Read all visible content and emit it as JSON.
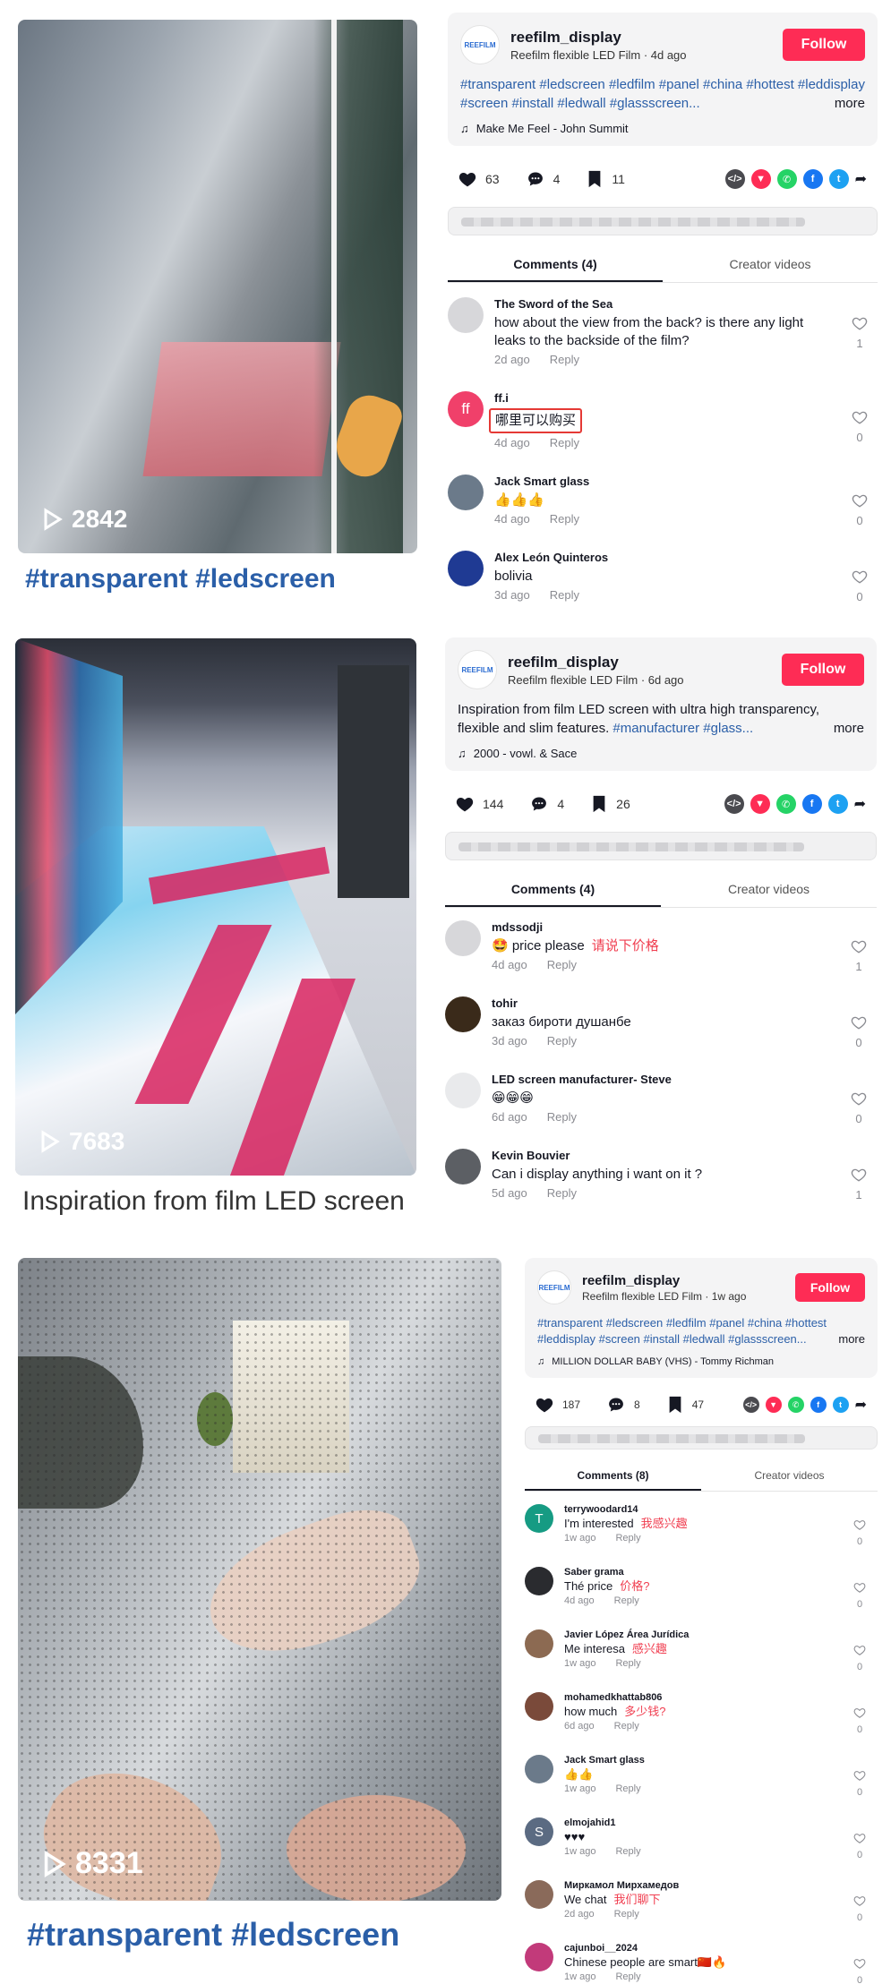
{
  "videos": [
    {
      "plays": "2842",
      "caption": "#transparent #ledscreen"
    },
    {
      "plays": "7683",
      "caption": "Inspiration from film LED screen"
    },
    {
      "plays": "8331",
      "caption": "#transparent #ledscreen"
    }
  ],
  "panels": [
    {
      "username": "reefilm_display",
      "subtitle": "Reefilm flexible LED Film · 4d ago",
      "follow_label": "Follow",
      "desc_text": "",
      "desc_tags": "#transparent #ledscreen #ledfilm #panel #china #hottest #leddisplay #screen #install #ledwall #glassscreen...",
      "more_label": "more",
      "music": "Make Me Feel - John Summit",
      "likes": "63",
      "comments_count": "4",
      "saves": "11",
      "tab_comments": "Comments (4)",
      "tab_creator": "Creator videos",
      "comments": [
        {
          "name": "The Sword of the Sea",
          "text": "how about the view from the back? is there any light leaks to the backside of the film?",
          "translation": "",
          "time": "2d ago",
          "reply": "Reply",
          "likes": "1",
          "avatar": "",
          "avatar_color": "#d7d7da"
        },
        {
          "name": "ff.i",
          "text": "哪里可以购买",
          "translation": "",
          "time": "4d ago",
          "reply": "Reply",
          "likes": "0",
          "avatar": "ff",
          "avatar_color": "#f0406a"
        },
        {
          "name": "Jack Smart glass",
          "text": "👍👍👍",
          "translation": "",
          "time": "4d ago",
          "reply": "Reply",
          "likes": "0",
          "avatar": "",
          "avatar_color": "#6b7a8a"
        },
        {
          "name": "Alex León Quinteros",
          "text": "bolivia",
          "translation": "",
          "time": "3d ago",
          "reply": "Reply",
          "likes": "0",
          "avatar": "",
          "avatar_color": "#1f3a93"
        }
      ]
    },
    {
      "username": "reefilm_display",
      "subtitle": "Reefilm flexible LED Film · 6d ago",
      "follow_label": "Follow",
      "desc_text": "Inspiration from film LED screen with ultra high transparency, flexible and slim features. ",
      "desc_tags": "#manufacturer #glass...",
      "more_label": "more",
      "music": "2000 - vowl. & Sace",
      "likes": "144",
      "comments_count": "4",
      "saves": "26",
      "tab_comments": "Comments (4)",
      "tab_creator": "Creator videos",
      "comments": [
        {
          "name": "mdssodji",
          "text": "🤩 price please",
          "translation": "请说下价格",
          "time": "4d ago",
          "reply": "Reply",
          "likes": "1",
          "avatar": "",
          "avatar_color": "#d7d7da"
        },
        {
          "name": "tohir",
          "text": "заказ бироти душанбе",
          "translation": "",
          "time": "3d ago",
          "reply": "Reply",
          "likes": "0",
          "avatar": "",
          "avatar_color": "#3a2a1a"
        },
        {
          "name": "LED screen manufacturer- Steve",
          "text": "😁😁😁",
          "translation": "",
          "time": "6d ago",
          "reply": "Reply",
          "likes": "0",
          "avatar": "",
          "avatar_color": "#e9eaec"
        },
        {
          "name": "Kevin Bouvier",
          "text": "Can i display anything i want on it ?",
          "translation": "",
          "time": "5d ago",
          "reply": "Reply",
          "likes": "1",
          "avatar": "",
          "avatar_color": "#5c5f64"
        }
      ]
    },
    {
      "username": "reefilm_display",
      "subtitle": "Reefilm flexible LED Film · 1w ago",
      "follow_label": "Follow",
      "desc_text": "",
      "desc_tags": "#transparent #ledscreen #ledfilm #panel #china #hottest #leddisplay #screen #install #ledwall #glassscreen...",
      "more_label": "more",
      "music": "MILLION DOLLAR BABY (VHS) - Tommy Richman",
      "likes": "187",
      "comments_count": "8",
      "saves": "47",
      "tab_comments": "Comments (8)",
      "tab_creator": "Creator videos",
      "comments": [
        {
          "name": "terrywoodard14",
          "text": "I'm interested",
          "translation": "我感兴趣",
          "time": "1w ago",
          "reply": "Reply",
          "likes": "0",
          "avatar": "T",
          "avatar_color": "#169b83"
        },
        {
          "name": "Saber grama",
          "text": "Thé price",
          "translation": "价格?",
          "time": "4d ago",
          "reply": "Reply",
          "likes": "0",
          "avatar": "",
          "avatar_color": "#2a2b2f"
        },
        {
          "name": "Javier López Área Jurídica",
          "text": "Me interesa",
          "translation": "感兴趣",
          "time": "1w ago",
          "reply": "Reply",
          "likes": "0",
          "avatar": "",
          "avatar_color": "#8c6a52"
        },
        {
          "name": "mohamedkhattab806",
          "text": "how much",
          "translation": "多少钱?",
          "time": "6d ago",
          "reply": "Reply",
          "likes": "0",
          "avatar": "",
          "avatar_color": "#7a4a3a"
        },
        {
          "name": "Jack Smart glass",
          "text": "👍👍",
          "translation": "",
          "time": "1w ago",
          "reply": "Reply",
          "likes": "0",
          "avatar": "",
          "avatar_color": "#6b7a8a"
        },
        {
          "name": "elmojahid1",
          "text": "♥♥♥",
          "translation": "",
          "time": "1w ago",
          "reply": "Reply",
          "likes": "0",
          "avatar": "S",
          "avatar_color": "#5b6b82"
        },
        {
          "name": "Миркамол Мирхамедов",
          "text": "We chat",
          "translation": "我们聊下",
          "time": "2d ago",
          "reply": "Reply",
          "likes": "0",
          "avatar": "",
          "avatar_color": "#8a6a5a"
        },
        {
          "name": "cajunboi__2024",
          "text": "Chinese people are smart🇨🇳🔥",
          "translation": "",
          "time": "1w ago",
          "reply": "Reply",
          "likes": "0",
          "avatar": "",
          "avatar_color": "#c23a7a"
        }
      ]
    }
  ],
  "colors": {
    "follow": "#fe2c55",
    "hashtag": "#2b5fa8",
    "translation": "#f03e50",
    "highlight_box": "#e53935"
  },
  "icons": [
    "play-icon",
    "heart-icon",
    "comment-icon",
    "bookmark-icon",
    "embed-icon",
    "friends-icon",
    "whatsapp-icon",
    "facebook-icon",
    "twitter-icon",
    "share-arrow-icon",
    "music-note-icon"
  ]
}
